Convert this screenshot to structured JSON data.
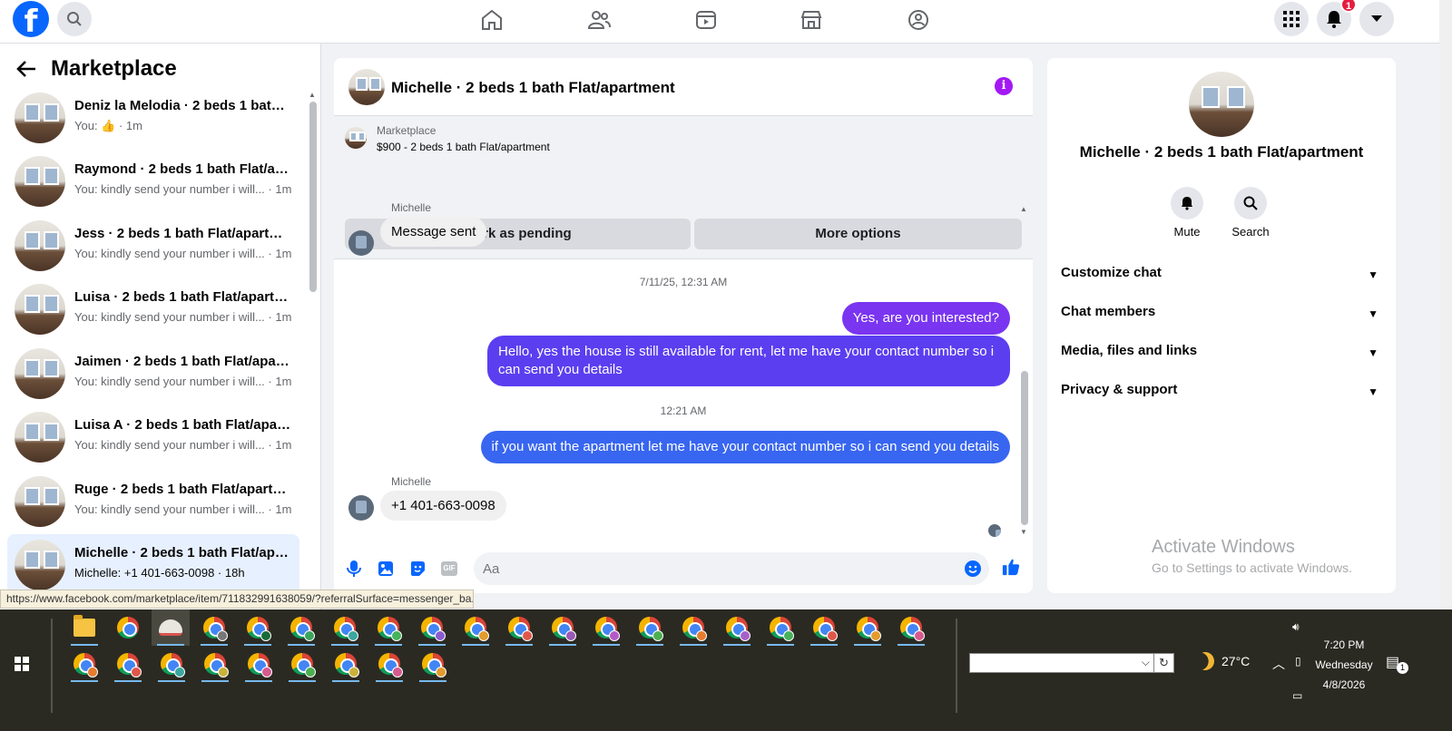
{
  "topbar": {
    "logo_letter": "f",
    "notifications_count": "1"
  },
  "left": {
    "title": "Marketplace",
    "conversations": [
      {
        "name": "Deniz la Melodia · 2 beds 1 bath Flat/apartment",
        "snippet_prefix": "You: ",
        "snippet": "",
        "time": " · 1m",
        "like": true
      },
      {
        "name": "Raymond · 2 beds 1 bath Flat/apartment",
        "snippet": "You: kindly send your number i will...",
        "time": " · 1m"
      },
      {
        "name": "Jess · 2 beds 1 bath Flat/apartment",
        "snippet": "You: kindly send your number i will...",
        "time": " · 1m"
      },
      {
        "name": "Luisa · 2 beds 1 bath Flat/apartment",
        "snippet": "You: kindly send your number i will...",
        "time": " · 1m"
      },
      {
        "name": "Jaimen · 2 beds 1 bath Flat/apartment",
        "snippet": "You: kindly send your number i will...",
        "time": " · 1m"
      },
      {
        "name": "Luisa A · 2 beds 1 bath Flat/apartment",
        "snippet": "You: kindly send your number i will...",
        "time": " · 1m"
      },
      {
        "name": "Ruge · 2 beds 1 bath Flat/apartment",
        "snippet": "You: kindly send your number i will...",
        "time": " · 1m"
      },
      {
        "name": "Michelle · 2 beds 1 bath Flat/apartment",
        "snippet": "Michelle: +1 401-663-0098",
        "time": " · 18h"
      }
    ]
  },
  "chat": {
    "title": "Michelle · 2 beds 1 bath Flat/apartment",
    "marketplace_label": "Marketplace",
    "listing": "$900 - 2 beds 1 bath Flat/apartment",
    "mark_pending": "Mark as pending",
    "more_options": "More options",
    "sender_name": "Michelle",
    "msg1": "Message sent",
    "ts1": "7/11/25, 12:31 AM",
    "out1": "Yes, are you interested?",
    "out2": "Hello, yes the house is still available for rent, let me have your contact number so i can send you details",
    "ts2": "12:21 AM",
    "out3": "if you want the apartment let me have your contact number so i can send you details",
    "sender_name2": "Michelle",
    "msg2": "+1 401-663-0098",
    "composer_placeholder": "Aa",
    "gif_label": "GIF",
    "colors": {
      "purple": "#7a35f0",
      "indigo": "#5b3ef0",
      "blue": "#3866f0"
    }
  },
  "right": {
    "title": "Michelle · 2 beds 1 bath Flat/apartment",
    "mute": "Mute",
    "search": "Search",
    "sections": [
      "Customize chat",
      "Chat members",
      "Media, files and links",
      "Privacy & support"
    ],
    "activate_title": "Activate Windows",
    "activate_sub": "Go to Settings to activate Windows."
  },
  "status_url": "https://www.facebook.com/marketplace/item/711832991638059/?referralSurface=messenger_ba...",
  "taskbar": {
    "temperature": "27°C",
    "time": "7:20 PM",
    "day": "Wednesday",
    "date": "4/8/2026",
    "notif_count": "1"
  }
}
